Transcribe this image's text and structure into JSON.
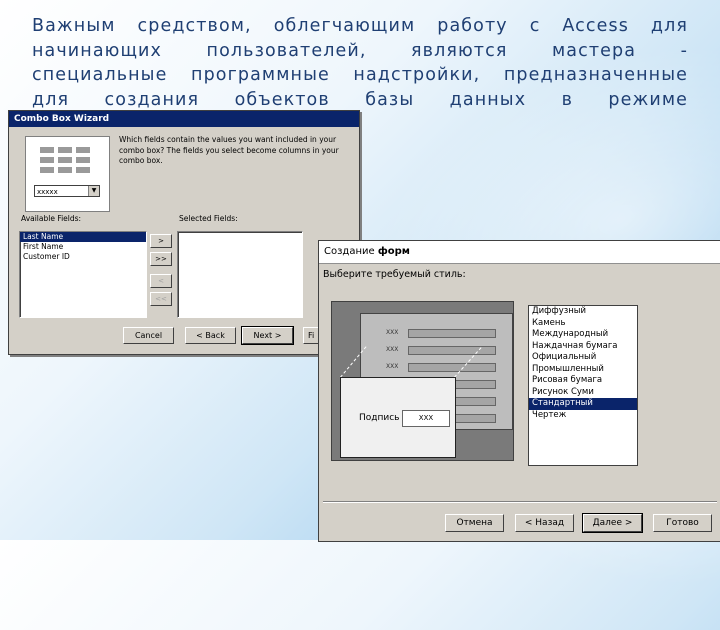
{
  "paragraph": {
    "line1": "Важным средством, облегчающим работу с Access для",
    "line2": "начинающих пользователей, являются мастера -",
    "line3": "специальные программные надстройки, предназначенные",
    "line4": "для создания объектов базы данных в режиме"
  },
  "combo_wizard": {
    "title": "Combo Box Wizard",
    "instruction": "Which fields contain the values you want included in your combo box? The fields you select become columns in your combo box.",
    "preview_combo_text": "xxxxx",
    "available_label": "Available Fields:",
    "selected_label": "Selected Fields:",
    "available_fields": [
      "Last Name",
      "First Name",
      "Customer ID"
    ],
    "move_buttons": [
      ">",
      ">>",
      "<",
      "<<"
    ],
    "cancel": "Cancel",
    "back": "< Back",
    "next": "Next >",
    "finish": "Fi"
  },
  "form_wizard": {
    "title_part1": "Создание ",
    "title_part2": "форм",
    "question": "Выберите требуемый стиль:",
    "placeholder_xxx": "XXX",
    "caption_label": "Подпись",
    "caption_value": "XXX",
    "styles": [
      "Диффузный",
      "Камень",
      "Международный",
      "Наждачная бумага",
      "Официальный",
      "Промышленный",
      "Рисовая бумага",
      "Рисунок Суми",
      "Стандартный",
      "Чертеж"
    ],
    "selected_style": "Стандартный",
    "cancel": "Отмена",
    "back": "< Назад",
    "next": "Далее >",
    "finish": "Готово"
  }
}
